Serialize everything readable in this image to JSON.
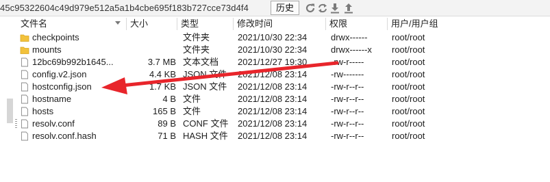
{
  "pathbar": {
    "path": "45c95322604c49d979e512a5a1b4cbe695f183b727cce73d4f4",
    "history_label": "历史",
    "icons": [
      "refresh-icon",
      "sync-icon",
      "download-icon",
      "upload-icon"
    ]
  },
  "columns": {
    "name": "文件名",
    "size": "大小",
    "type": "类型",
    "modified": "修改时间",
    "permissions": "权限",
    "owner": "用户/用户组"
  },
  "files": [
    {
      "name": "checkpoints",
      "size": "",
      "type": "文件夹",
      "modified": "2021/10/30 22:34",
      "permissions": "drwx------",
      "owner": "root/root",
      "icon": "folder-icon"
    },
    {
      "name": "mounts",
      "size": "",
      "type": "文件夹",
      "modified": "2021/10/30 22:34",
      "permissions": "drwx------x",
      "owner": "root/root",
      "icon": "folder-icon"
    },
    {
      "name": "12bc69b992b1645...",
      "size": "3.7 MB",
      "type": "文本文档",
      "modified": "2021/12/27 19:30",
      "permissions": "-rw-r-----",
      "owner": "root/root",
      "icon": "file-icon"
    },
    {
      "name": "config.v2.json",
      "size": "4.4 KB",
      "type": "JSON 文件",
      "modified": "2021/12/08 23:14",
      "permissions": "-rw-------",
      "owner": "root/root",
      "icon": "file-icon"
    },
    {
      "name": "hostconfig.json",
      "size": "1.7 KB",
      "type": "JSON 文件",
      "modified": "2021/12/08 23:14",
      "permissions": "-rw-r--r--",
      "owner": "root/root",
      "icon": "file-icon"
    },
    {
      "name": "hostname",
      "size": "4 B",
      "type": "文件",
      "modified": "2021/12/08 23:14",
      "permissions": "-rw-r--r--",
      "owner": "root/root",
      "icon": "file-icon"
    },
    {
      "name": "hosts",
      "size": "165 B",
      "type": "文件",
      "modified": "2021/12/08 23:14",
      "permissions": "-rw-r--r--",
      "owner": "root/root",
      "icon": "file-icon"
    },
    {
      "name": "resolv.conf",
      "size": "89 B",
      "type": "CONF 文件",
      "modified": "2021/12/08 23:14",
      "permissions": "-rw-r--r--",
      "owner": "root/root",
      "icon": "file-icon"
    },
    {
      "name": "resolv.conf.hash",
      "size": "71 B",
      "type": "HASH 文件",
      "modified": "2021/12/08 23:14",
      "permissions": "-rw-r--r--",
      "owner": "root/root",
      "icon": "file-icon"
    }
  ],
  "annotation": {
    "color": "#e8252b",
    "points_to": "hostconfig.json"
  },
  "colors": {
    "folder": "#f2c23c",
    "folder_dark": "#d9a520",
    "icon_gray": "#7a7a7a"
  }
}
